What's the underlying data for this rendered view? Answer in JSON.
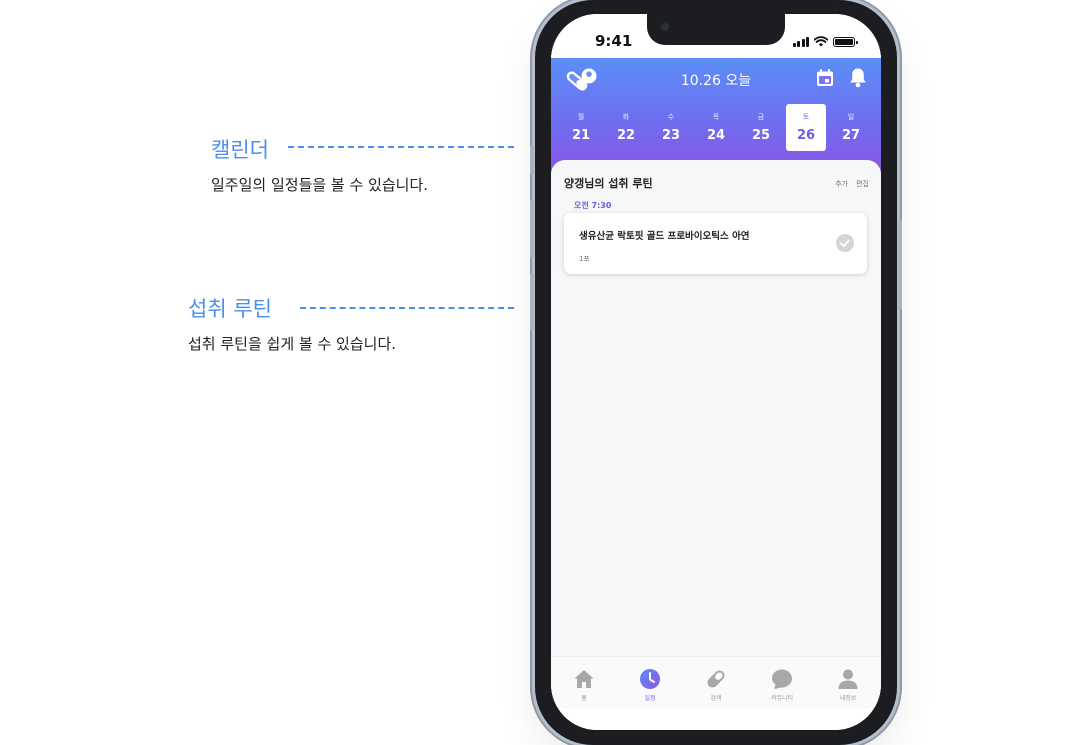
{
  "annotations": [
    {
      "title": "캘린더",
      "description": "일주일의 일정들을 볼 수 있습니다."
    },
    {
      "title": "섭취 루틴",
      "description": "섭취 루틴을 쉽게 볼 수 있습니다."
    }
  ],
  "status_bar": {
    "time": "9:41"
  },
  "header": {
    "title": "10.26 오늘"
  },
  "week": [
    {
      "name": "월",
      "date": "21"
    },
    {
      "name": "화",
      "date": "22"
    },
    {
      "name": "수",
      "date": "23"
    },
    {
      "name": "목",
      "date": "24"
    },
    {
      "name": "금",
      "date": "25"
    },
    {
      "name": "토",
      "date": "26",
      "selected": true
    },
    {
      "name": "일",
      "date": "27"
    }
  ],
  "routine": {
    "title": "양갱님의 섭취 루틴",
    "add_label": "추가",
    "edit_label": "편집",
    "time": "오전 7:30",
    "item": {
      "name": "생유산균 락토핏 골드 프로바이오틱스 아연",
      "dose": "1포"
    }
  },
  "tabs": [
    {
      "label": "홈",
      "icon": "home-icon"
    },
    {
      "label": "일정",
      "icon": "clock-icon",
      "active": true
    },
    {
      "label": "검색",
      "icon": "pill-icon"
    },
    {
      "label": "커뮤니티",
      "icon": "chat-icon"
    },
    {
      "label": "내정보",
      "icon": "person-icon"
    }
  ],
  "colors": {
    "accent": "#6c5ce7",
    "annotation": "#4a8ff0",
    "header_top": "#5b8ef7",
    "header_bottom": "#8a55e6"
  }
}
